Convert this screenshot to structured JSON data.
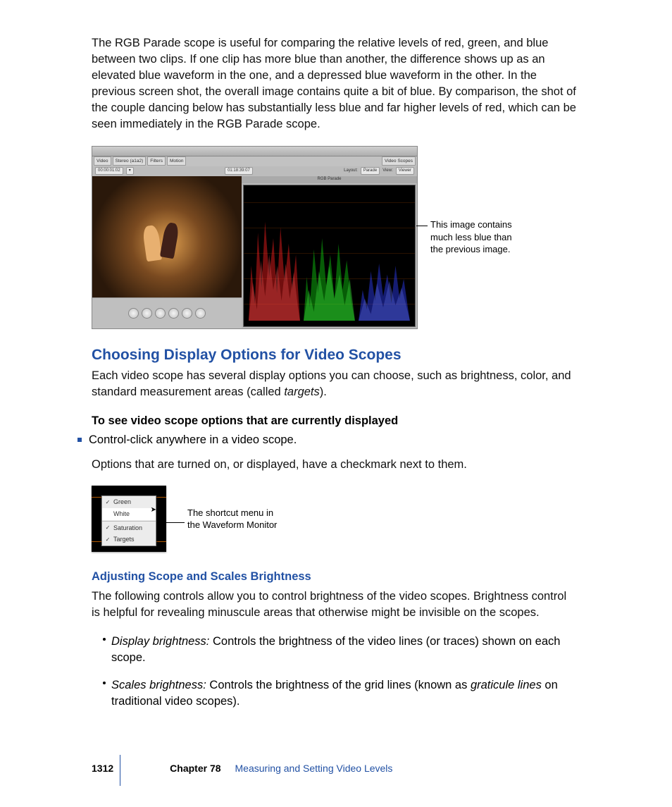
{
  "intro_para": "The RGB Parade scope is useful for comparing the relative levels of red, green, and blue between two clips. If one clip has more blue than another, the difference shows up as an elevated blue waveform in the one, and a depressed blue waveform in the other. In the previous screen shot, the overall image contains quite a bit of blue. By comparison, the shot of the couple dancing below has substantially less blue and far higher levels of red, which can be seen immediately in the RGB Parade scope.",
  "screenshot": {
    "tabs": [
      "Video",
      "Stereo (a1a2)",
      "Filters",
      "Motion"
    ],
    "scope_tab": "Video Scopes",
    "timecode_left": "00:00:01:02",
    "timecode_right": "01:18:39:07",
    "layout_label": "Layout:",
    "layout_value": "Parade",
    "view_label": "View:",
    "view_value": "Viewer",
    "scope_title": "RGB Parade"
  },
  "fig1_callout_l1": "This image contains",
  "fig1_callout_l2": "much less blue than",
  "fig1_callout_l3": "the previous image.",
  "h2": "Choosing Display Options for Video Scopes",
  "h2_para": "Each video scope has several display options you can choose, such as brightness, color, and standard measurement areas (called ",
  "h2_para_em": "targets",
  "h2_para_end": ").",
  "bold_lead": "To see video scope options that are currently displayed",
  "bullet1": "Control-click anywhere in a video scope.",
  "after_bullet": "Options that are turned on, or displayed, have a checkmark next to them.",
  "menu": {
    "item1": "Green",
    "item2": "White",
    "item3": "Saturation",
    "item4": "Targets"
  },
  "fig2_callout_l1": "The shortcut menu in",
  "fig2_callout_l2": "the Waveform Monitor",
  "h3": "Adjusting Scope and Scales Brightness",
  "h3_para": "The following controls allow you to control brightness of the video scopes. Brightness control is helpful for revealing minuscule areas that otherwise might be invisible on the scopes.",
  "d1_term": "Display brightness:",
  "d1_body": "  Controls the brightness of the video lines (or traces) shown on each scope.",
  "d2_term": "Scales brightness:",
  "d2_body_a": "  Controls the brightness of the grid lines (known as ",
  "d2_body_em": "graticule lines",
  "d2_body_b": " on traditional video scopes).",
  "footer": {
    "page": "1312",
    "chapter_label": "Chapter 78",
    "chapter_title": "Measuring and Setting Video Levels"
  }
}
